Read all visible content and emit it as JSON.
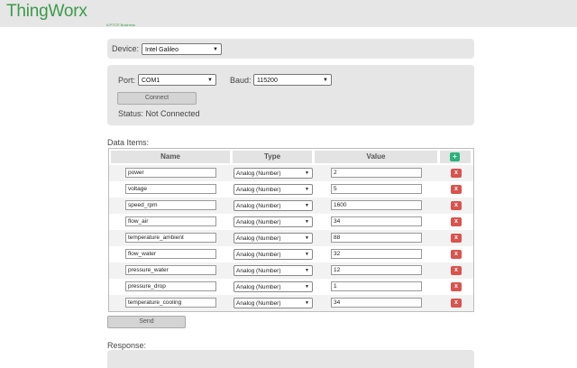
{
  "header": {
    "brand": "ThingWorx",
    "brand_sub": "A PTC® Business"
  },
  "device": {
    "label": "Device:",
    "selected": "Intel Galileo"
  },
  "connection": {
    "port_label": "Port:",
    "port_value": "COM1",
    "baud_label": "Baud:",
    "baud_value": "115200",
    "connect_button": "Connect",
    "status": "Status: Not Connected"
  },
  "data_items": {
    "section_label": "Data Items:",
    "columns": [
      "Name",
      "Type",
      "Value"
    ],
    "add_label": "+",
    "delete_label": "x",
    "rows": [
      {
        "name": "power",
        "type": "Analog (Number)",
        "value": "2"
      },
      {
        "name": "voltage",
        "type": "Analog (Number)",
        "value": "5"
      },
      {
        "name": "speed_rpm",
        "type": "Analog (Number)",
        "value": "1600"
      },
      {
        "name": "flow_air",
        "type": "Analog (Number)",
        "value": "34"
      },
      {
        "name": "temperature_ambient",
        "type": "Analog (Number)",
        "value": "88"
      },
      {
        "name": "flow_water",
        "type": "Analog (Number)",
        "value": "32"
      },
      {
        "name": "pressure_water",
        "type": "Analog (Number)",
        "value": "12"
      },
      {
        "name": "pressure_drop",
        "type": "Analog (Number)",
        "value": "1"
      },
      {
        "name": "temperature_cooling",
        "type": "Analog (Number)",
        "value": "34"
      }
    ]
  },
  "send_button": "Send",
  "response": {
    "label": "Response:"
  }
}
